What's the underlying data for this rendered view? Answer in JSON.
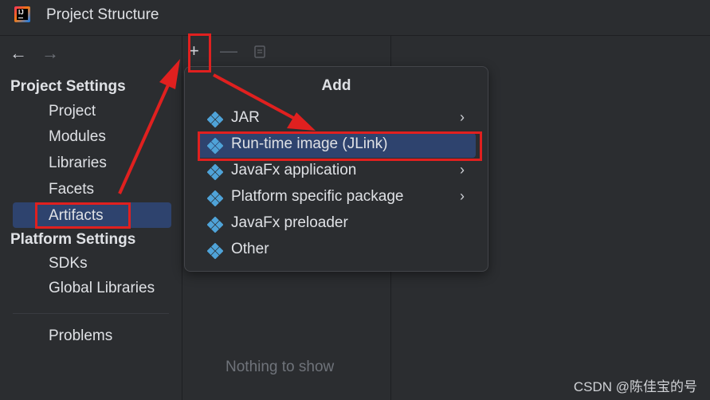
{
  "window": {
    "title": "Project Structure"
  },
  "sidebar": {
    "project_settings_header": "Project Settings",
    "project_items": [
      {
        "label": "Project"
      },
      {
        "label": "Modules"
      },
      {
        "label": "Libraries"
      },
      {
        "label": "Facets"
      },
      {
        "label": "Artifacts",
        "selected": true
      }
    ],
    "platform_settings_header": "Platform Settings",
    "platform_items": [
      {
        "label": "SDKs"
      },
      {
        "label": "Global Libraries"
      }
    ],
    "problems_label": "Problems"
  },
  "middle": {
    "empty_text": "Nothing to show"
  },
  "toolbar": {
    "add_icon": "plus-icon",
    "remove_icon": "minus-icon",
    "copy_icon": "copy-icon"
  },
  "popup": {
    "title": "Add",
    "items": [
      {
        "label": "JAR",
        "has_submenu": true
      },
      {
        "label": "Run-time image (JLink)",
        "has_submenu": false,
        "hovered": true
      },
      {
        "label": "JavaFx application",
        "has_submenu": true
      },
      {
        "label": "Platform specific package",
        "has_submenu": true
      },
      {
        "label": "JavaFx preloader",
        "has_submenu": false
      },
      {
        "label": "Other",
        "has_submenu": false
      }
    ]
  },
  "watermark": "CSDN @陈佳宝的号",
  "colors": {
    "background": "#2b2d30",
    "selection": "#2e436e",
    "annotation_red": "#e0201f",
    "artifact_icon": "#4fa3d8"
  }
}
